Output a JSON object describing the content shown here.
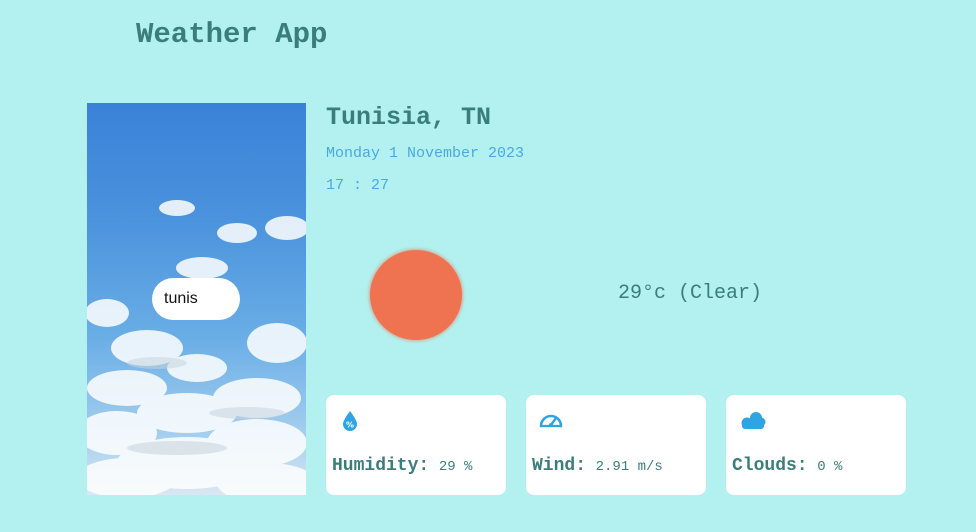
{
  "app": {
    "title": "Weather App"
  },
  "search": {
    "value": "tunis"
  },
  "location": {
    "name": "Tunisia, TN",
    "date": "Monday 1 November 2023",
    "time": "17 : 27"
  },
  "current": {
    "temperature": "29°c (Clear)",
    "icon": "sun-icon"
  },
  "cards": [
    {
      "label": "Humidity:",
      "value": "29 %",
      "icon": "humidity-drop-icon"
    },
    {
      "label": "Wind:",
      "value": "2.91 m/s",
      "icon": "speedometer-icon"
    },
    {
      "label": "Clouds:",
      "value": "0 %",
      "icon": "clouds-icon"
    }
  ],
  "colors": {
    "background": "#b2f1ef",
    "accent": "#3a7e7c",
    "secondary": "#4aa8e0",
    "sun": "#ef7350",
    "icon": "#2ea4e4"
  }
}
